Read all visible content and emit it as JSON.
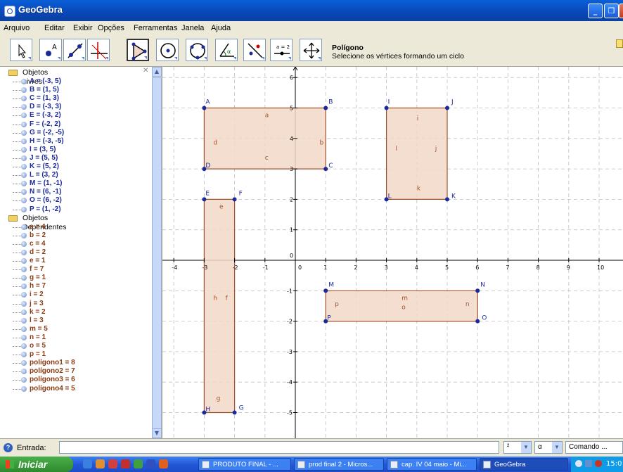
{
  "window": {
    "title": "GeoGebra"
  },
  "menu": [
    "Arquivo",
    "Editar",
    "Exibir",
    "Opções",
    "Ferramentas",
    "Janela",
    "Ajuda"
  ],
  "tool_info": {
    "name": "Polígono",
    "help": "Selecione os vértices formando um ciclo"
  },
  "tools": [
    "move-tool-icon",
    "point-tool-icon",
    "line-tool-icon",
    "perpendicular-tool-icon",
    "polygon-tool-icon",
    "circle-center-tool-icon",
    "circle-three-points-tool-icon",
    "angle-tool-icon",
    "reflect-tool-icon",
    "slider-tool-icon",
    "move-view-tool-icon"
  ],
  "slider_tool_label": "a = 2",
  "algebra": {
    "free_header": "Objetos Livres",
    "free": [
      "A = (-3, 5)",
      "B = (1, 5)",
      "C = (1, 3)",
      "D = (-3, 3)",
      "E = (-3, 2)",
      "F = (-2, 2)",
      "G = (-2, -5)",
      "H = (-3, -5)",
      "I = (3, 5)",
      "J = (5, 5)",
      "K = (5, 2)",
      "L = (3, 2)",
      "M = (1, -1)",
      "N = (6, -1)",
      "O = (6, -2)",
      "P = (1, -2)"
    ],
    "dependent_header": "Objetos Dependentes",
    "dependent": [
      "a = 4",
      "b = 2",
      "c = 4",
      "d = 2",
      "e = 1",
      "f = 7",
      "g = 1",
      "h = 7",
      "i = 2",
      "j = 3",
      "k = 2",
      "l = 3",
      "m = 5",
      "n = 1",
      "o = 5",
      "p = 1",
      "polígono1 = 8",
      "polígono2 = 7",
      "polígono3 = 6",
      "polígono4 = 5"
    ]
  },
  "input_bar": {
    "label": "Entrada:",
    "combo1": "²",
    "combo2": "α",
    "combo3": "Comando ..."
  },
  "taskbar": {
    "start": "Iniciar",
    "tasks": [
      "PRODUTO FINAL - ...",
      "prod final 2 - Micros...",
      "cap. IV 04 maio - Mi...",
      "GeoGebra"
    ],
    "clock": "15:0"
  },
  "graph": {
    "x_ticks": [
      "-4",
      "-3",
      "-2",
      "-1",
      "0",
      "1",
      "2",
      "3",
      "4",
      "5",
      "6",
      "7",
      "8",
      "9",
      "10"
    ],
    "y_ticks": [
      "6",
      "5",
      "4",
      "3",
      "2",
      "1",
      "0",
      "-1",
      "-2",
      "-3",
      "-4",
      "-5"
    ],
    "points": {
      "A": [
        -3,
        5
      ],
      "B": [
        1,
        5
      ],
      "C": [
        1,
        3
      ],
      "D": [
        -3,
        3
      ],
      "E": [
        -3,
        2
      ],
      "F": [
        -2,
        2
      ],
      "G": [
        -2,
        -5
      ],
      "H": [
        -3,
        -5
      ],
      "I": [
        3,
        5
      ],
      "J": [
        5,
        5
      ],
      "K": [
        5,
        2
      ],
      "L": [
        3,
        2
      ],
      "M": [
        1,
        -1
      ],
      "N": [
        6,
        -1
      ],
      "O": [
        6,
        -2
      ],
      "P": [
        1,
        -2
      ]
    },
    "polygons": [
      [
        "A",
        "B",
        "C",
        "D"
      ],
      [
        "E",
        "F",
        "G",
        "H"
      ],
      [
        "I",
        "J",
        "K",
        "L"
      ],
      [
        "M",
        "N",
        "O",
        "P"
      ]
    ],
    "segment_labels": [
      "a",
      "b",
      "c",
      "d",
      "e",
      "f",
      "g",
      "h",
      "i",
      "j",
      "k",
      "l",
      "m",
      "n",
      "o",
      "p"
    ],
    "colors": {
      "fill": "#f2d8c8",
      "edge": "#a0522d",
      "point": "#1a2a9a",
      "axis": "#000000",
      "grid": "#c0c0c0"
    }
  }
}
